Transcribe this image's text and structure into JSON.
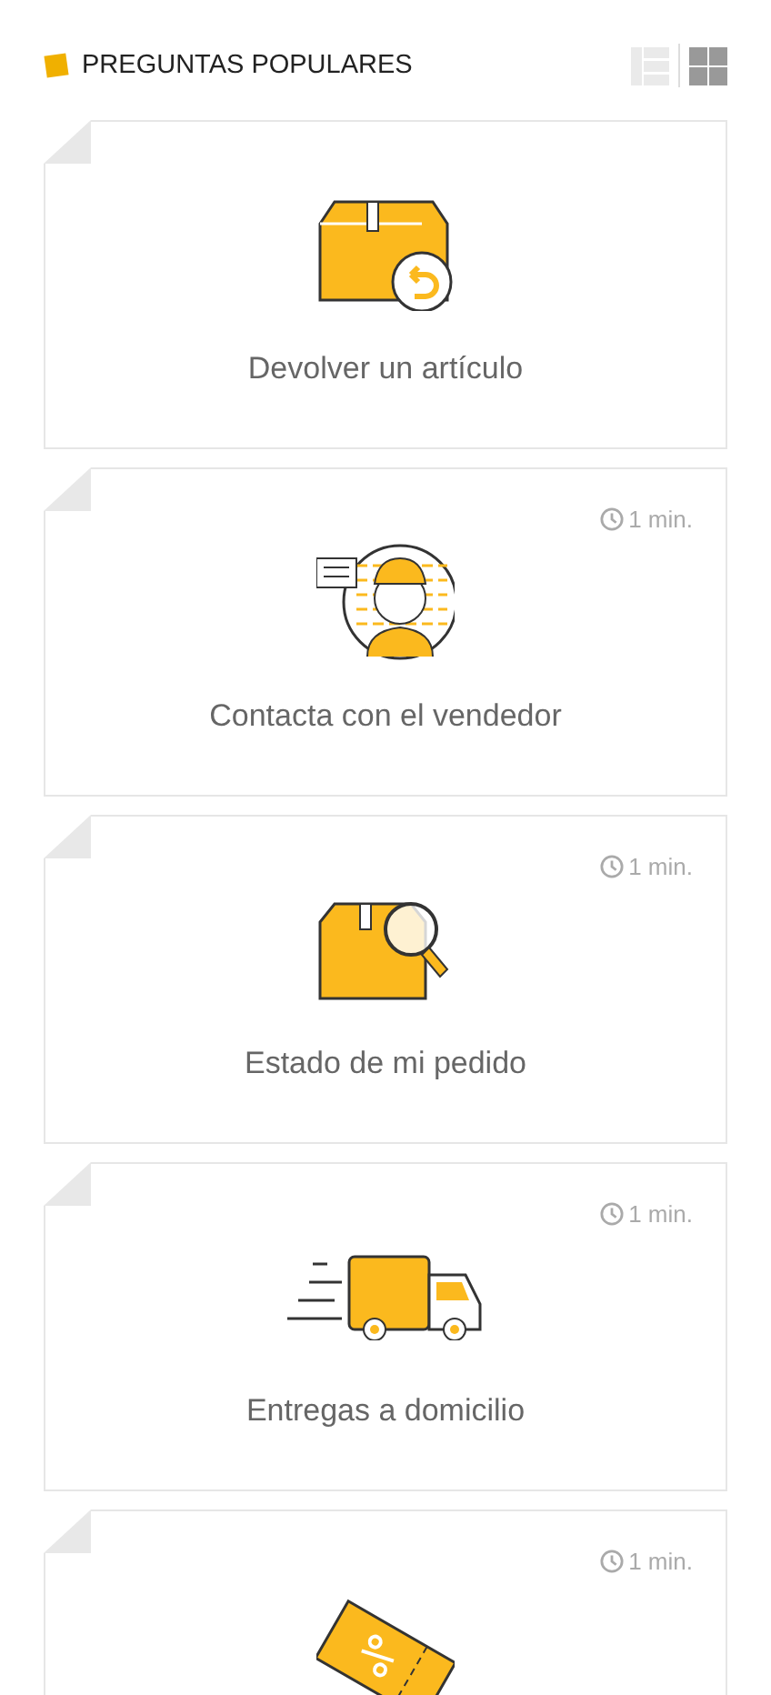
{
  "header": {
    "title": "PREGUNTAS POPULARES"
  },
  "view_toggles": [
    {
      "kind": "list",
      "selected": false
    },
    {
      "kind": "grid",
      "selected": true
    }
  ],
  "cards": [
    {
      "kind": "return",
      "title": "Devolver un artículo"
    },
    {
      "kind": "seller",
      "time": "1 min.",
      "title": "Contacta con el vendedor"
    },
    {
      "kind": "search",
      "time": "1 min.",
      "title": "Estado de mi pedido"
    },
    {
      "kind": "truck",
      "time": "1 min.",
      "title": "Entregas a domicilio"
    },
    {
      "kind": "coupon",
      "time": "1 min."
    }
  ]
}
